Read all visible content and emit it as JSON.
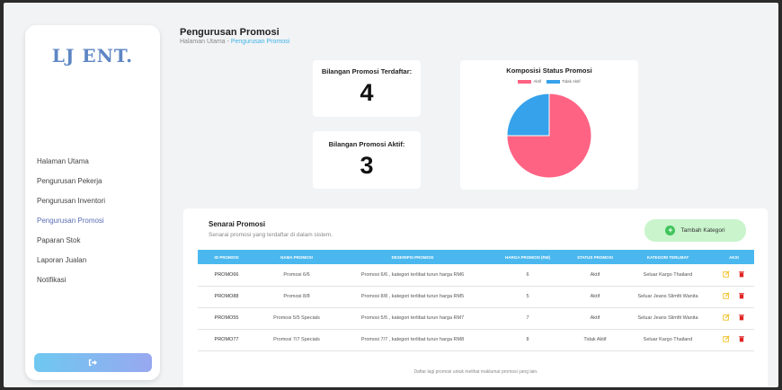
{
  "sidebar": {
    "logo": "LJ ENT.",
    "items": [
      {
        "label": "Halaman Utama"
      },
      {
        "label": "Pengurusan Pekerja"
      },
      {
        "label": "Pengurusan Inventori"
      },
      {
        "label": "Pengurusan Promosi"
      },
      {
        "label": "Paparan Stok"
      },
      {
        "label": "Laporan Jualan"
      },
      {
        "label": "Notifikasi"
      }
    ],
    "active_index": 3,
    "logout_icon": "logout-icon"
  },
  "header": {
    "title": "Pengurusan Promosi",
    "breadcrumb_home": "Halaman Utama",
    "breadcrumb_sep": " - ",
    "breadcrumb_current": "Pengurusan Promosi"
  },
  "stats": {
    "registered_label": "Bilangan Promosi Terdaftar:",
    "registered_value": "4",
    "active_label": "Bilangan Promosi Aktif:",
    "active_value": "3"
  },
  "chart": {
    "title": "Komposisi Status Promosi",
    "chart_data": {
      "type": "pie",
      "title": "Komposisi Status Promosi",
      "categories": [
        "Aktif",
        "Tidak Aktif"
      ],
      "values": [
        3,
        1
      ],
      "colors": [
        "#ff6384",
        "#36a2eb"
      ],
      "legend": "top"
    }
  },
  "section": {
    "title": "Senarai Promosi",
    "subtitle": "Senarai promosi yang terdaftar di dalam sistem.",
    "add_button": "Tambah Kategori",
    "footer": "Daftar lagi promosi untuk melihat maklumat promosi yang lain."
  },
  "table": {
    "columns": [
      "ID Promosi",
      "Nama Promosi",
      "Deskripsi Promosi",
      "Harga Promosi (RM)",
      "Status Promosi",
      "Kategori Terlibat",
      "Aksi"
    ],
    "rows": [
      {
        "id": "PROMO66",
        "name": "Promosi 6/6",
        "desc": "Promosi 6/6 , kategori terlibat turun harga RM6",
        "price": "6",
        "status": "Aktif",
        "category": "Seluar Kargo Thailand"
      },
      {
        "id": "PROMO88",
        "name": "Promosi 8/8",
        "desc": "Promosi 8/8 , kategori terlibat turun harga RM5",
        "price": "5",
        "status": "Aktif",
        "category": "Seluar Jeans Slimfit Wanita"
      },
      {
        "id": "PROMO55",
        "name": "Promosi 5/5 Specials",
        "desc": "Promosi 5/5 , kategori terlibat turun harga RM7",
        "price": "7",
        "status": "Aktif",
        "category": "Seluar Jeans Slimfit Wanita"
      },
      {
        "id": "PROMO77",
        "name": "Promosi 7/7 Specials",
        "desc": "Promosi 7/7 , kategori terlibat turun harga RM8",
        "price": "8",
        "status": "Tidak Aktif",
        "category": "Seluar Kargo Thailand"
      }
    ],
    "edit_icon": "edit-icon",
    "delete_icon": "trash-icon"
  }
}
